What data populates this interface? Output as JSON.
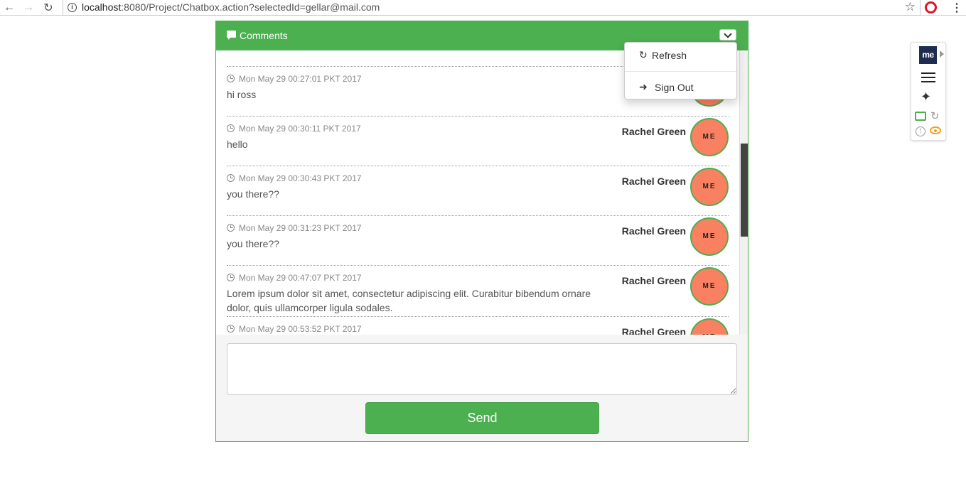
{
  "browser": {
    "url_host": "localhost",
    "url_path": ":8080/Project/Chatbox.action?selectedId=gellar@mail.com"
  },
  "panel": {
    "title": "Comments",
    "header_color": "#4caf50"
  },
  "menu": {
    "refresh_label": "Refresh",
    "signout_label": "Sign Out"
  },
  "messages": [
    {
      "time": "Mon May 29 00:27:01 PKT 2017",
      "text": "hi ross",
      "author": "R",
      "avatar": "ME"
    },
    {
      "time": "Mon May 29 00:30:11 PKT 2017",
      "text": "hello",
      "author": "Rachel Green",
      "avatar": "ME"
    },
    {
      "time": "Mon May 29 00:30:43 PKT 2017",
      "text": "you there??",
      "author": "Rachel Green",
      "avatar": "ME"
    },
    {
      "time": "Mon May 29 00:31:23 PKT 2017",
      "text": "you there??",
      "author": "Rachel Green",
      "avatar": "ME"
    },
    {
      "time": "Mon May 29 00:47:07 PKT 2017",
      "text": "Lorem ipsum dolor sit amet, consectetur adipiscing elit. Curabitur bibendum ornare dolor, quis ullamcorper ligula sodales.",
      "author": "Rachel Green",
      "avatar": "ME"
    },
    {
      "time": "Mon May 29 00:53:52 PKT 2017",
      "text": "",
      "author": "Rachel Green",
      "avatar": "ME"
    }
  ],
  "composer": {
    "placeholder": "",
    "send_label": "Send"
  },
  "extension": {
    "logo_text": "me"
  },
  "colors": {
    "accent": "#4caf50",
    "avatar": "#fa8062"
  }
}
